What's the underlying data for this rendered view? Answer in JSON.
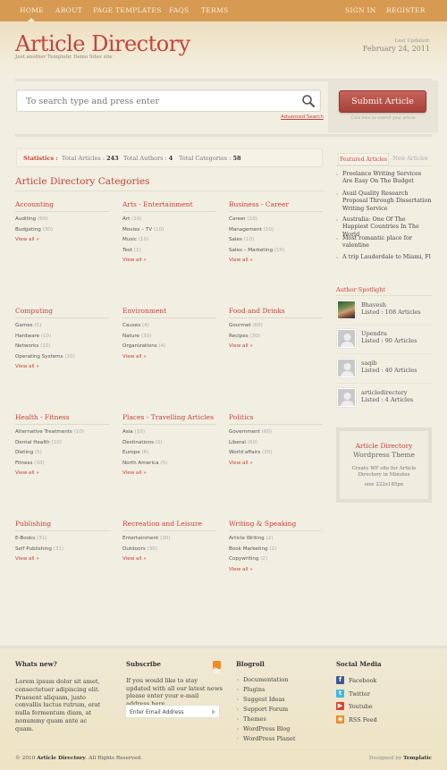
{
  "nav": {
    "left": [
      "HOME",
      "ABOUT",
      "PAGE TEMPLATES",
      "FAQS",
      "TERMS"
    ],
    "right": [
      "SIGN IN",
      "REGISTER"
    ],
    "active": "HOME"
  },
  "header": {
    "title": "Article Directory",
    "tagline": "Just another Templatic Demo Sites site",
    "updated_label": "Last Updated:",
    "updated_date": "February 24, 2011"
  },
  "search": {
    "placeholder": "To search type and press enter",
    "icon": "search-icon",
    "advanced_label": "Advanced Search"
  },
  "submit": {
    "label": "Submit Article",
    "hint": "Click here to submit your article"
  },
  "stats": {
    "label": "Statistics :",
    "articles_label": "Total Articles :",
    "articles": "243",
    "authors_label": "Total Authors :",
    "authors": "4",
    "categories_label": "Total Categories :",
    "categories": "58"
  },
  "categories": {
    "heading": "Article Directory Categories",
    "view_all": "View all »",
    "groups": [
      {
        "title": "Accounting",
        "items": [
          {
            "name": "Auditing",
            "count": "(60)"
          },
          {
            "name": "Budgeting",
            "count": "(30)"
          }
        ]
      },
      {
        "title": "Arts - Entertainment",
        "items": [
          {
            "name": "Art",
            "count": "(10)"
          },
          {
            "name": "Movies – TV",
            "count": "(10)"
          },
          {
            "name": "Music",
            "count": "(10)"
          },
          {
            "name": "Test",
            "count": "(1)"
          }
        ]
      },
      {
        "title": "Business - Career",
        "items": [
          {
            "name": "Career",
            "count": "(10)"
          },
          {
            "name": "Management",
            "count": "(10)"
          },
          {
            "name": "Sales",
            "count": "(10)"
          },
          {
            "name": "Sales – Marketing",
            "count": "(10)"
          }
        ]
      },
      {
        "title": "Computing",
        "items": [
          {
            "name": "Games",
            "count": "(5)"
          },
          {
            "name": "Hardware",
            "count": "(10)"
          },
          {
            "name": "Networks",
            "count": "(10)"
          },
          {
            "name": "Operating Systems",
            "count": "(10)"
          }
        ]
      },
      {
        "title": "Environment",
        "items": [
          {
            "name": "Causes",
            "count": "(4)"
          },
          {
            "name": "Nature",
            "count": "(30)"
          },
          {
            "name": "Organizations",
            "count": "(4)"
          }
        ]
      },
      {
        "title": "Food and Drinks",
        "items": [
          {
            "name": "Gourmet",
            "count": "(60)"
          },
          {
            "name": "Recipes",
            "count": "(30)"
          }
        ]
      },
      {
        "title": "Health - Fitness",
        "items": [
          {
            "name": "Alternative Treatments",
            "count": "(10)"
          },
          {
            "name": "Dental Health",
            "count": "(10)"
          },
          {
            "name": "Dieting",
            "count": "(5)"
          },
          {
            "name": "Fitness",
            "count": "(10)"
          }
        ]
      },
      {
        "title": "Places - Travelling Articles",
        "items": [
          {
            "name": "Asia",
            "count": "(10)"
          },
          {
            "name": "Destinations",
            "count": "(5)"
          },
          {
            "name": "Europe",
            "count": "(6)"
          },
          {
            "name": "North America",
            "count": "(5)"
          }
        ]
      },
      {
        "title": "Politics",
        "items": [
          {
            "name": "Government",
            "count": "(60)"
          },
          {
            "name": "Liberal",
            "count": "(60)"
          },
          {
            "name": "World affairs",
            "count": "(30)"
          }
        ]
      },
      {
        "title": "Publishing",
        "items": [
          {
            "name": "E-Books",
            "count": "(31)"
          },
          {
            "name": "Self Publishing",
            "count": "(31)"
          }
        ]
      },
      {
        "title": "Recreation and Leisure",
        "items": [
          {
            "name": "Entertainment",
            "count": "(30)"
          },
          {
            "name": "Outdoors",
            "count": "(30)"
          }
        ]
      },
      {
        "title": "Writing & Speaking",
        "items": [
          {
            "name": "Article Writing",
            "count": "(2)"
          },
          {
            "name": "Book Marketing",
            "count": "(2)"
          },
          {
            "name": "Copywriting",
            "count": "(2)"
          }
        ]
      }
    ]
  },
  "sidebar": {
    "tabs": [
      "Featured Articles",
      "New Articles"
    ],
    "active_tab": "Featured Articles",
    "featured": [
      "Freelance Writing Services Are Easy On The Budget",
      "Avail Quality Research Proposal Through Dissertation Writing Service",
      "Australia: One Of The Happiest Countries In The World",
      "Most romantic place for valentine",
      "A trip Lauderdale to Miami, Fl"
    ],
    "spotlight_title": "Author Spotlight",
    "authors": [
      {
        "name": "Bhavesh",
        "listed": "Listed : 108 Articles",
        "avatar": "photo"
      },
      {
        "name": "Upendra",
        "listed": "Listed : 90 Articles",
        "avatar": "default"
      },
      {
        "name": "saqib",
        "listed": "Listed : 40 Articles",
        "avatar": "default"
      },
      {
        "name": "articledirectory",
        "listed": "Listed : 4 Articles",
        "avatar": "default"
      }
    ],
    "ad": {
      "line1": "Article Directory",
      "line2": "Wordpress Theme",
      "line3": "Create WP site for Article Directory in Minutes",
      "line4": "size 222x185px"
    }
  },
  "footer": {
    "whats_new_title": "Whats new?",
    "whats_new_text": "Lorem ipsum dolor sit amet, consectetuer adipiscing elit. Praesent aliquam, justo convallis luctus rutrum, erat nulla fermentum diam, at nonummy quam ante ac quam.",
    "subscribe_title": "Subscribe",
    "subscribe_text": "If you would like to stay updated with all our latest news please enter your e-mail address here",
    "email_placeholder": "Enter Email Address",
    "blogroll_title": "Blogroll",
    "blogroll": [
      "Documentation",
      "Plugins",
      "Suggest Ideas",
      "Support Forum",
      "Themes",
      "WordPress Blog",
      "WordPress Planet"
    ],
    "social_title": "Social Media",
    "social": [
      {
        "label": "Facebook",
        "icon": "facebook-icon",
        "color": "#3b5998",
        "glyph": "f"
      },
      {
        "label": "Twitter",
        "icon": "twitter-icon",
        "color": "#3fb7e8",
        "glyph": "t"
      },
      {
        "label": "Youtube",
        "icon": "youtube-icon",
        "color": "#d9422f",
        "glyph": "▶"
      },
      {
        "label": "RSS Feed",
        "icon": "rss-icon",
        "color": "#f08a24",
        "glyph": "◉"
      }
    ],
    "copyright_prefix": "© 2010",
    "copyright_brand": "Article Directory",
    "copyright_suffix": ". All Rights Reserved.",
    "designed_by_label": "Designed by",
    "designed_by": "Templatic"
  },
  "colors": {
    "accent": "#c8423a",
    "nav_bar": "#d69a52",
    "background": "#f1eee2",
    "submit_button": "#b34c44"
  }
}
